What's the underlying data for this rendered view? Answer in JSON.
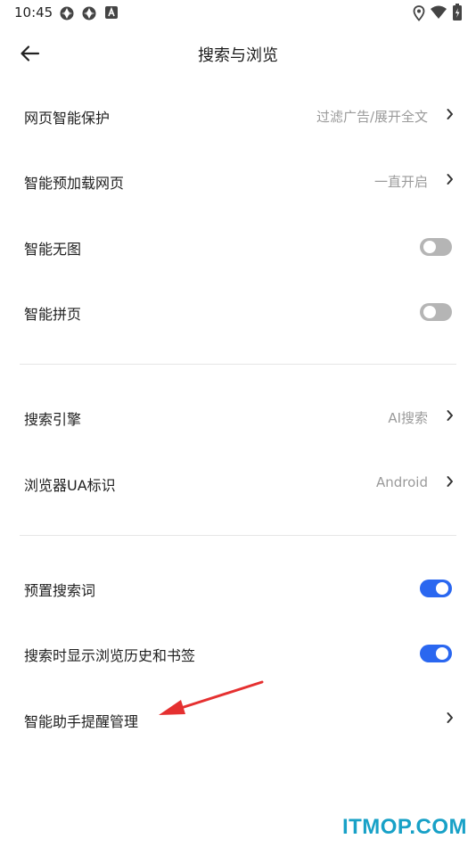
{
  "status_bar": {
    "time": "10:45",
    "icons": [
      "app-notification-icon",
      "app-notification-icon",
      "text-notification-icon",
      "location-icon",
      "wifi-icon",
      "battery-icon"
    ]
  },
  "header": {
    "title": "搜索与浏览",
    "back_icon": "arrow-left-icon"
  },
  "sections": [
    {
      "items": [
        {
          "label": "网页智能保护",
          "value": "过滤广告/展开全文",
          "control": "chevron"
        },
        {
          "label": "智能预加载网页",
          "value": "一直开启",
          "control": "chevron"
        },
        {
          "label": "智能无图",
          "control": "toggle",
          "checked": false
        },
        {
          "label": "智能拼页",
          "control": "toggle",
          "checked": false
        }
      ]
    },
    {
      "items": [
        {
          "label": "搜索引擎",
          "value": "AI搜索",
          "control": "chevron"
        },
        {
          "label": "浏览器UA标识",
          "value": "Android",
          "control": "chevron"
        }
      ]
    },
    {
      "items": [
        {
          "label": "预置搜索词",
          "control": "toggle",
          "checked": true
        },
        {
          "label": "搜索时显示浏览历史和书签",
          "control": "toggle",
          "checked": true
        },
        {
          "label": "智能助手提醒管理",
          "control": "chevron"
        }
      ]
    }
  ],
  "watermark": "ITMOP.COM",
  "colors": {
    "toggle_on": "#2a67f0",
    "toggle_off": "#b5b5b5",
    "annotation_arrow": "#e53030",
    "watermark": "#18a1c7"
  }
}
